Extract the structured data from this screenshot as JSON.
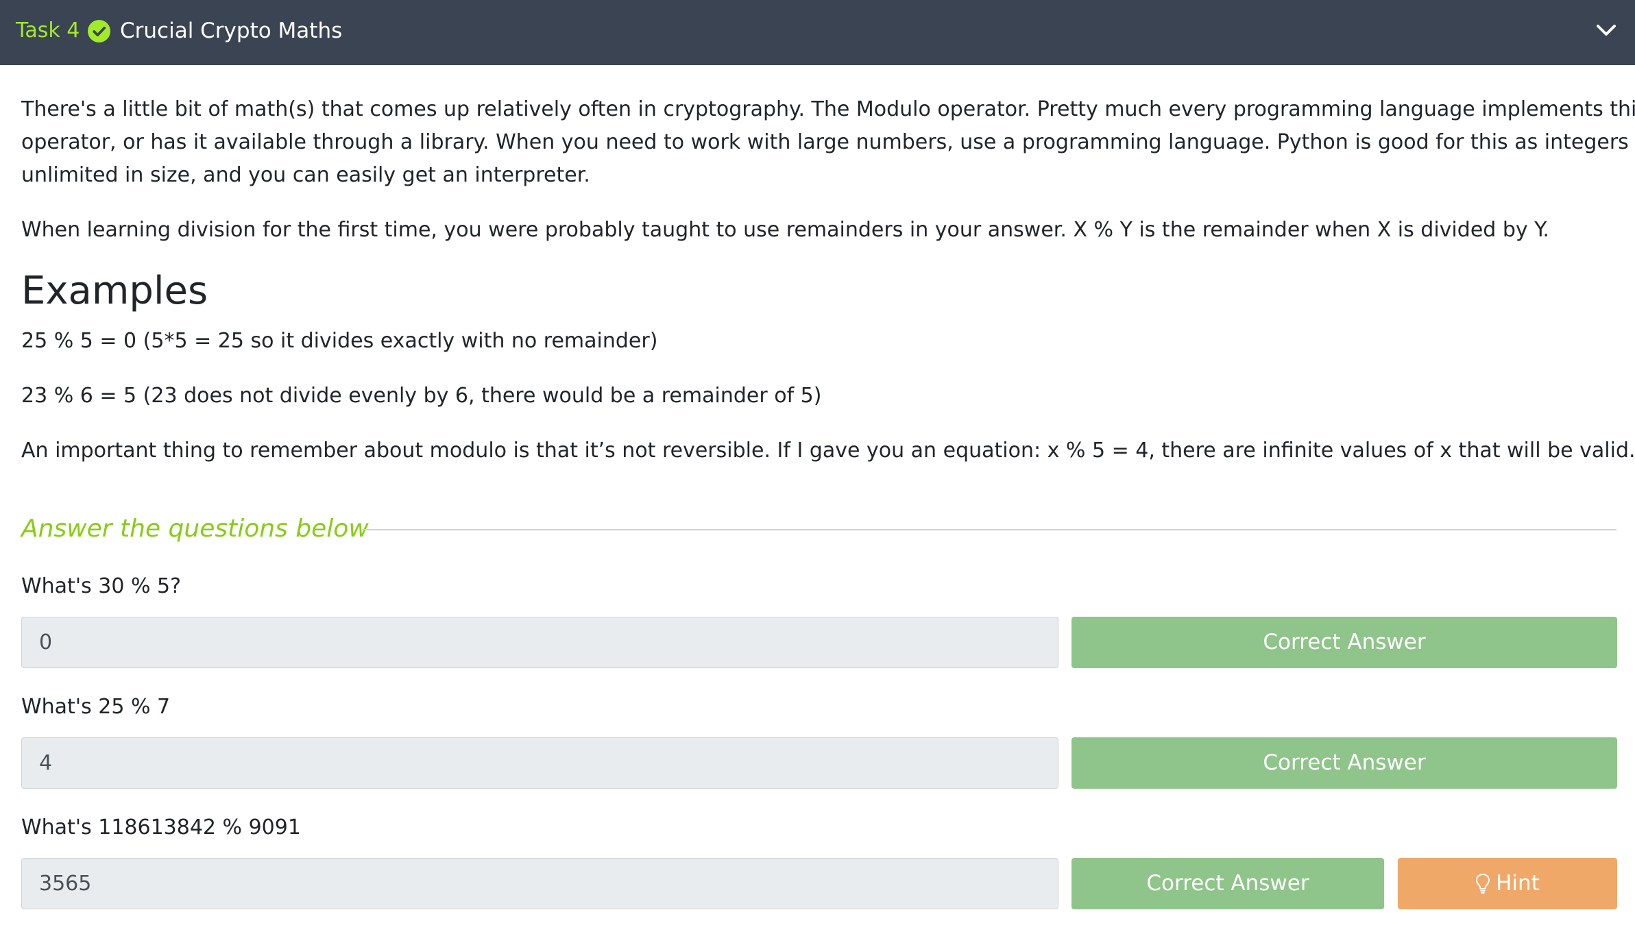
{
  "header": {
    "task_number": "Task 4",
    "title": "Crucial Crypto Maths",
    "colors": {
      "background": "#3a4452",
      "task_number": "#a3ea2a",
      "check": "#a3ea2a"
    },
    "icons": {
      "status": "check-circle-icon",
      "toggle": "chevron-down-icon"
    }
  },
  "body": {
    "paragraph_1": {
      "line_1": "There's a little bit of math(s) that comes up relatively often in cryptography. The Modulo operator. Pretty much every programming language implements this",
      "line_2": "operator, or has it available through a library. When you need to work with large numbers, use a programming language. Python is good for this as integers are",
      "line_3": "unlimited in size, and you can easily get an interpreter."
    },
    "paragraph_2": "When learning division for the first time, you were probably taught to use remainders in your answer. X % Y is the remainder when X is divided by Y.",
    "examples_heading": "Examples",
    "example_1": "25 % 5 = 0 (5*5 = 25 so it divides exactly with no remainder)",
    "example_2": "23 % 6 = 5 (23 does not divide evenly by 6, there would be a remainder of 5)",
    "paragraph_3": "An important thing to remember about modulo is that it’s not reversible. If I gave you an equation: x % 5 = 4, there are infinite values of x that will be valid."
  },
  "questions_section": {
    "heading": "Answer the questions below",
    "accent_color": "#88cc14",
    "questions": [
      {
        "question": "What's 30 % 5?",
        "answer_value": "0",
        "button_label": "Correct Answer"
      },
      {
        "question": "What's 25 % 7",
        "answer_value": "4",
        "button_label": "Correct Answer"
      },
      {
        "question": "What's 118613842 % 9091",
        "answer_value": "3565",
        "button_label": "Correct Answer",
        "hint_label": "Hint",
        "hint_icon": "lightbulb-icon"
      }
    ],
    "button_colors": {
      "correct": "#8fc48a",
      "hint": "#f0a868"
    }
  }
}
